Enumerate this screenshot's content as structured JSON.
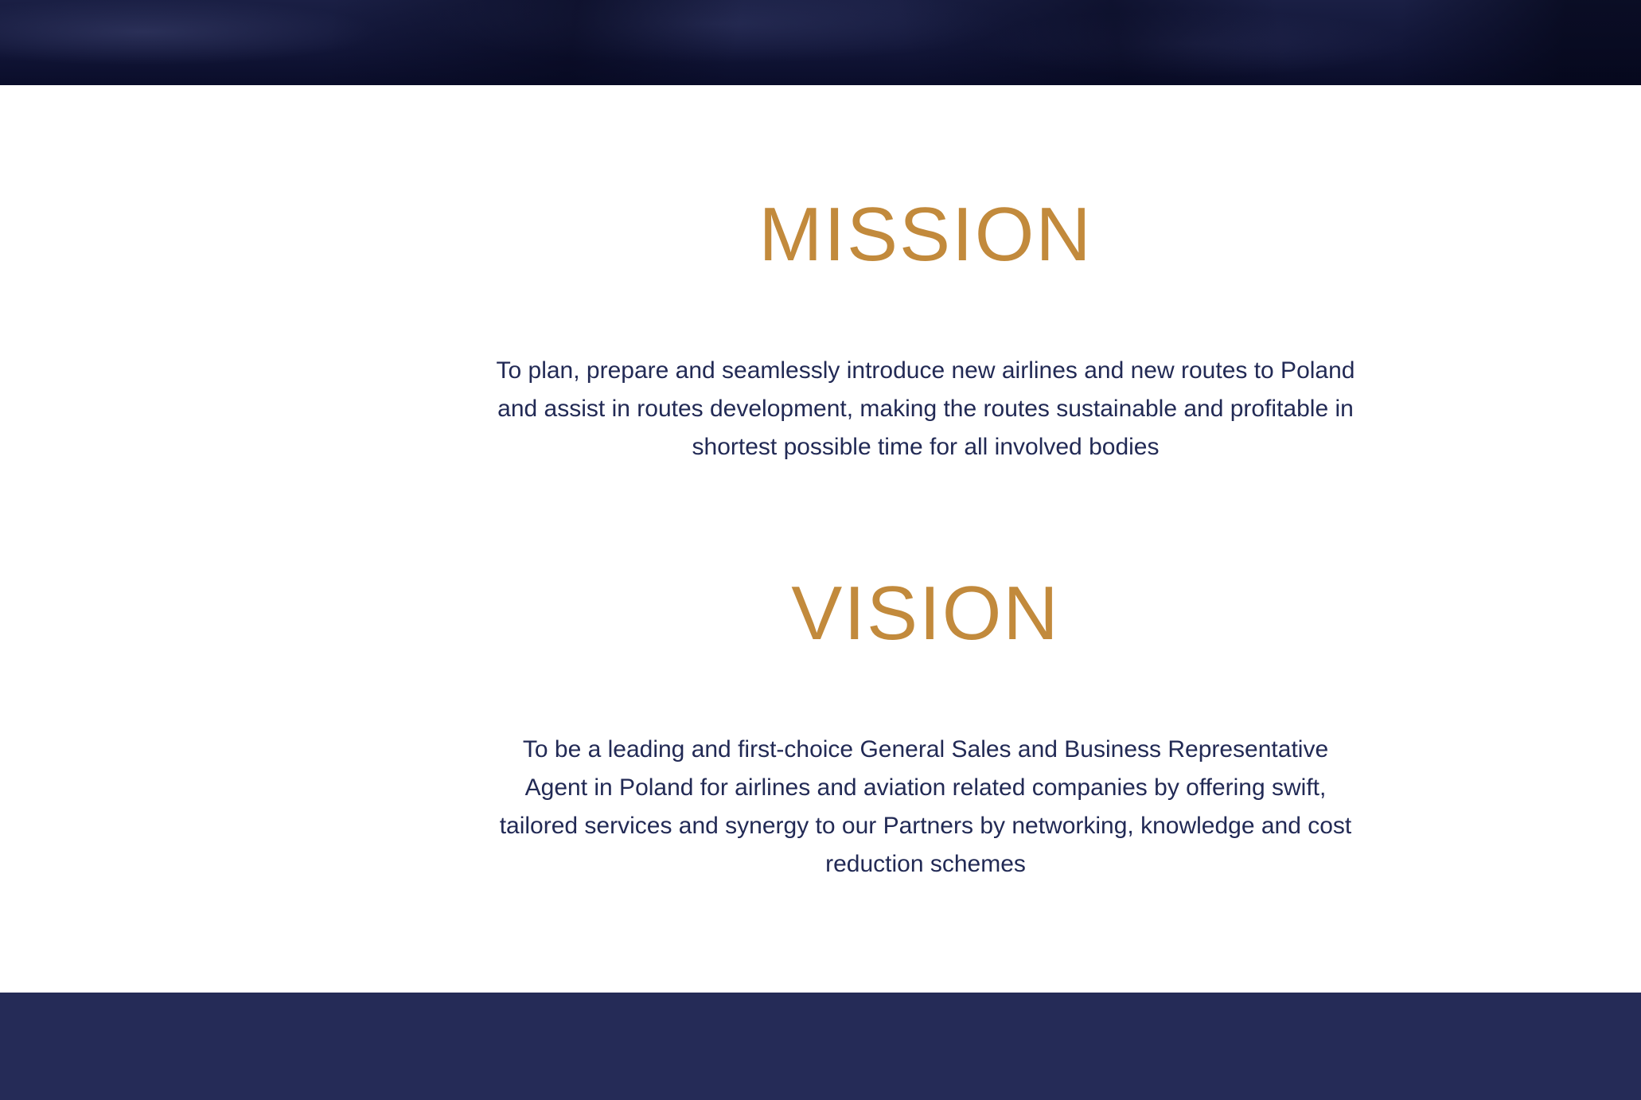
{
  "mission": {
    "heading": "MISSION",
    "text": "To plan, prepare and seamlessly introduce new airlines and new routes to Poland and assist in routes development, making the routes sustainable and profitable in shortest possible time for all involved bodies"
  },
  "vision": {
    "heading": "VISION",
    "text": "To be a leading and first-choice General Sales and Business Representative Agent in Poland for airlines and aviation related companies by offering swift, tailored services and synergy to our Partners by networking, knowledge and cost reduction schemes"
  },
  "colors": {
    "heading": "#c28a3c",
    "body_text": "#222a55",
    "footer": "#252b57",
    "banner": "#121638"
  }
}
